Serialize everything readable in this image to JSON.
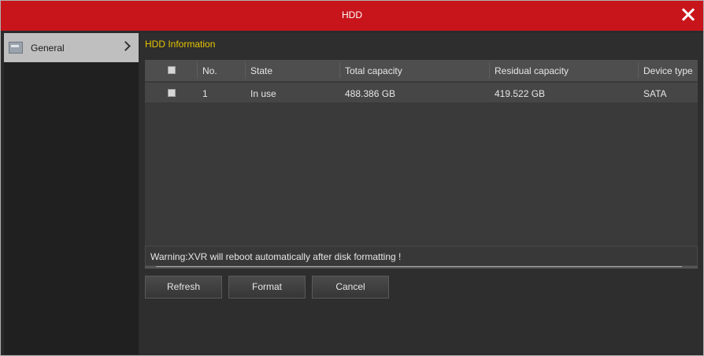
{
  "window": {
    "title": "HDD"
  },
  "sidebar": {
    "items": [
      {
        "label": "General"
      }
    ]
  },
  "main": {
    "section_title": "HDD Information",
    "table": {
      "columns": [
        "No.",
        "State",
        "Total capacity",
        "Residual capacity",
        "Device type"
      ],
      "rows": [
        {
          "no": "1",
          "state": "In use",
          "total": "488.386 GB",
          "residual": "419.522 GB",
          "type": "SATA"
        }
      ]
    },
    "warning": "Warning:XVR will reboot automatically after disk formatting !",
    "buttons": {
      "refresh": "Refresh",
      "format": "Format",
      "cancel": "Cancel"
    }
  },
  "colors": {
    "titlebar": "#c8151c",
    "section_title": "#e8c400"
  }
}
